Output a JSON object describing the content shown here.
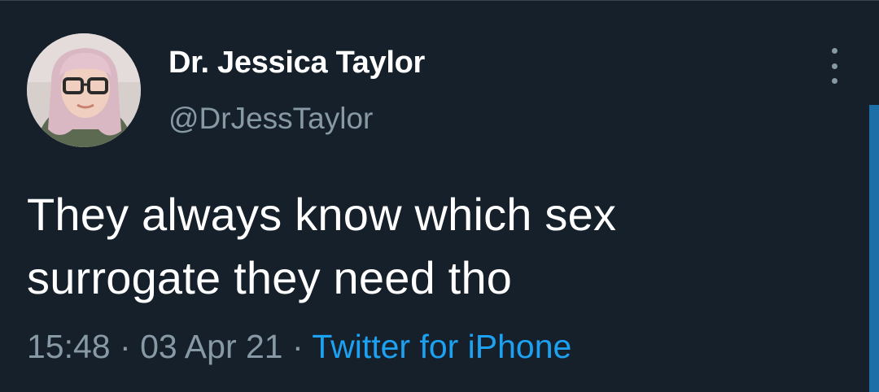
{
  "tweet": {
    "author_name": "Dr. Jessica Taylor",
    "author_handle": "@DrJessTaylor",
    "text_line1": "They always know which sex",
    "text_line2": "surrogate they need tho",
    "time": "15:48",
    "separator": "·",
    "date": "03 Apr 21",
    "source": "Twitter for iPhone"
  },
  "icons": {
    "more": "more-vertical-icon"
  },
  "colors": {
    "background": "#15202b",
    "primary_text": "#ffffff",
    "secondary_text": "#8899a6",
    "link": "#1da1f2"
  }
}
